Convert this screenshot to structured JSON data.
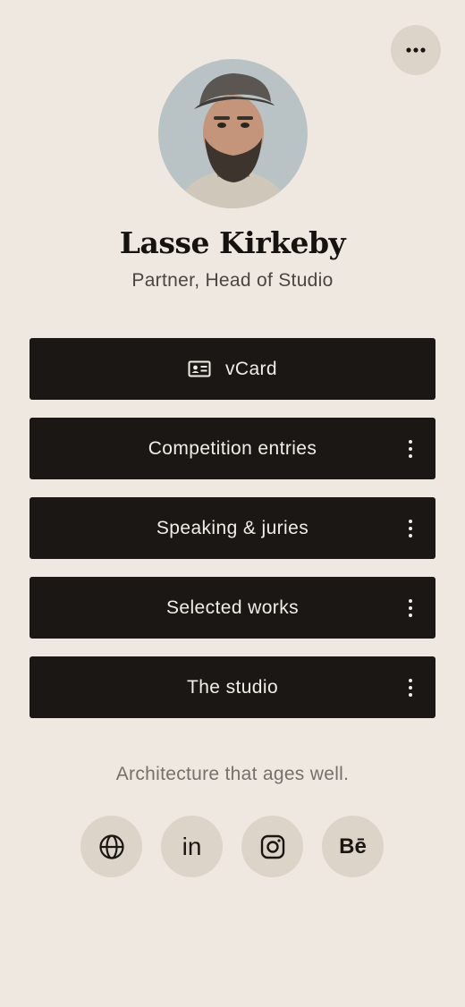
{
  "profile": {
    "name": "Lasse Kirkeby",
    "role": "Partner, Head of Studio"
  },
  "links": [
    {
      "label": "vCard",
      "icon": "id-card-icon",
      "has_menu": false
    },
    {
      "label": "Competition entries",
      "has_menu": true
    },
    {
      "label": "Speaking & juries",
      "has_menu": true
    },
    {
      "label": "Selected works",
      "has_menu": true
    },
    {
      "label": "The studio",
      "has_menu": true
    }
  ],
  "tagline": "Architecture that ages well.",
  "socials": [
    {
      "icon": "globe-icon"
    },
    {
      "icon": "linkedin-icon",
      "glyph": "in"
    },
    {
      "icon": "instagram-icon"
    },
    {
      "icon": "behance-icon",
      "glyph": "Bē"
    }
  ],
  "colors": {
    "background": "#efe8e0",
    "button": "#1a1714",
    "button_text": "#f3ede6",
    "chip": "#ddd4c9"
  }
}
